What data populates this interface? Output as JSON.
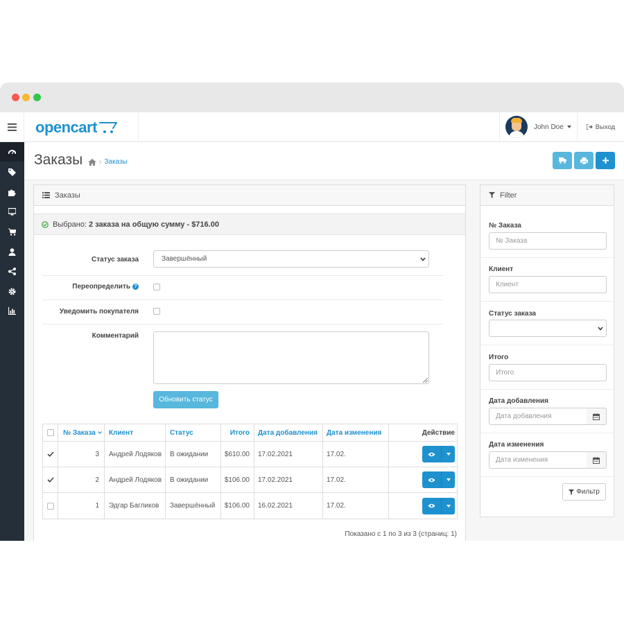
{
  "header": {
    "logo_text": "opencart",
    "user_name": "John Doe",
    "logout_label": "Выход"
  },
  "sidebar": {
    "icons": [
      "dashboard-icon",
      "tag-icon",
      "puzzle-icon",
      "monitor-icon",
      "cart-icon",
      "user-icon",
      "share-icon",
      "gear-icon",
      "bar-chart-icon"
    ]
  },
  "page": {
    "title": "Заказы",
    "breadcrumb_current": "Заказы"
  },
  "orders_panel": {
    "heading": "Заказы",
    "selected_prefix": "Выбрано:",
    "selected_summary": "2 заказа на общую сумму - $716.00",
    "status_label": "Статус заказа",
    "status_value": "Завершённый",
    "override_label": "Переопределить",
    "notify_label": "Уведомить покупателя",
    "comment_label": "Комментарий",
    "update_button": "Обновить статус",
    "pagination_text": "Показано с 1 по 3 из 3 (страниц: 1)"
  },
  "table": {
    "columns": [
      "№ Заказа",
      "Клиент",
      "Статус",
      "Итого",
      "Дата добавления",
      "Дата изменения",
      "Действие"
    ],
    "rows": [
      {
        "checked": true,
        "id": "3",
        "customer": "Андрей Лодяков",
        "status": "В ожидании",
        "total": "$610.00",
        "date_added": "17.02.2021",
        "date_modified": "17.02."
      },
      {
        "checked": true,
        "id": "2",
        "customer": "Андрей Лодяков",
        "status": "В ожидании",
        "total": "$106.00",
        "date_added": "17.02.2021",
        "date_modified": "17.02."
      },
      {
        "checked": false,
        "id": "1",
        "customer": "Эдгар Багликов",
        "status": "Завершённый",
        "total": "$106.00",
        "date_added": "16.02.2021",
        "date_modified": "17.02."
      }
    ]
  },
  "filter": {
    "heading": "Filter",
    "order_id_label": "№ Заказа",
    "order_id_placeholder": "№ Заказа",
    "customer_label": "Клиент",
    "customer_placeholder": "Клиент",
    "status_label": "Статус заказа",
    "total_label": "Итого",
    "total_placeholder": "Итого",
    "date_added_label": "Дата добавления",
    "date_added_placeholder": "Дата добавления",
    "date_modified_label": "Дата изменения",
    "date_modified_placeholder": "Дата изменения",
    "filter_button": "Фильтр"
  },
  "colors": {
    "accent": "#1e91cf",
    "accent_light": "#58b7dc",
    "sidebar_bg": "#252f3a"
  }
}
